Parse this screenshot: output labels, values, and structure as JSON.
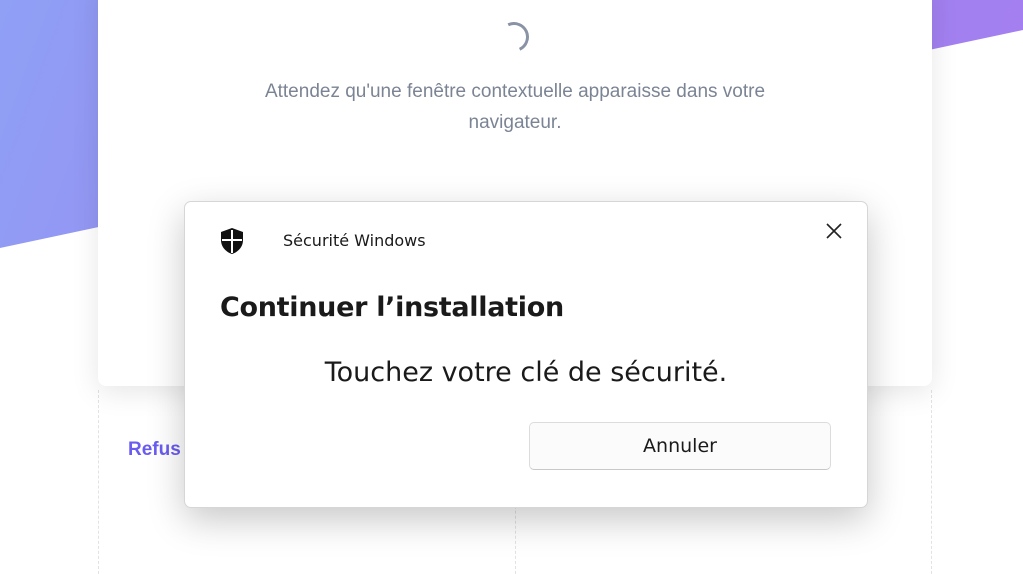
{
  "web_page": {
    "wait_message": "Attendez qu'une fenêtre contextuelle apparaisse dans votre navigateur.",
    "refuse_link": "Refus"
  },
  "dialog": {
    "app_title": "Sécurité Windows",
    "shield_icon": "shield-icon",
    "close_icon": "close-icon",
    "heading": "Continuer l’installation",
    "message": "Touchez votre clé de sécurité.",
    "cancel_label": "Annuler"
  },
  "colors": {
    "gradient_start": "#8fa0f5",
    "gradient_end": "#a57ef0",
    "link": "#6a5cf0",
    "muted_text": "#7b8494"
  }
}
